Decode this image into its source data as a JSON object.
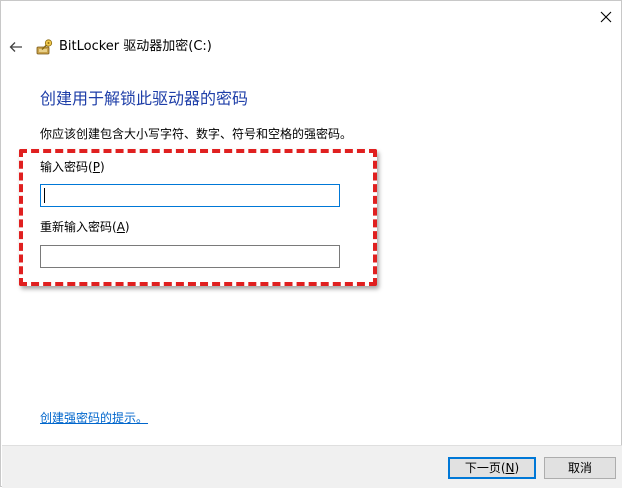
{
  "window": {
    "title": "BitLocker 驱动器加密(C:)"
  },
  "page": {
    "heading": "创建用于解锁此驱动器的密码",
    "description": "你应该创建包含大小写字符、数字、符号和空格的强密码。"
  },
  "fields": {
    "password": {
      "label_prefix": "输入密码(",
      "label_key": "P",
      "label_suffix": ")",
      "value": "",
      "placeholder": ""
    },
    "confirm": {
      "label_prefix": "重新输入密码(",
      "label_key": "A",
      "label_suffix": ")",
      "value": "",
      "placeholder": ""
    }
  },
  "hint_link": "创建强密码的提示。",
  "footer": {
    "next_label_prefix": "下一页(",
    "next_label_key": "N",
    "next_label_suffix": ")",
    "cancel_label": "取消"
  },
  "icons": {
    "close": "close-icon",
    "back": "back-arrow-icon",
    "app": "bitlocker-key-icon"
  },
  "colors": {
    "heading": "#1e3ea8",
    "link": "#0066cc",
    "highlight": "#e02020",
    "focus": "#0078d7",
    "footer_bg": "#f0f0f0"
  }
}
